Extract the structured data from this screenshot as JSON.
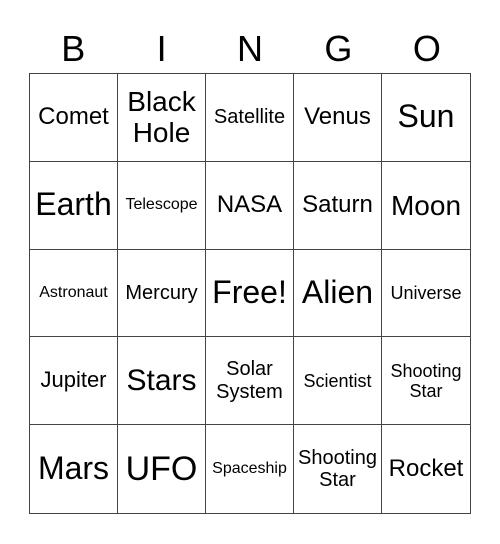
{
  "header": [
    "B",
    "I",
    "N",
    "G",
    "O"
  ],
  "cells": [
    "Comet",
    "Black\nHole",
    "Satellite",
    "Venus",
    "Sun",
    "Earth",
    "Telescope",
    "NASA",
    "Saturn",
    "Moon",
    "Astronaut",
    "Mercury",
    "Free!",
    "Alien",
    "Universe",
    "Jupiter",
    "Stars",
    "Solar\nSystem",
    "Scientist",
    "Shooting\nStar",
    "Mars",
    "UFO",
    "Spaceship",
    "Shooting\nStar",
    "Rocket"
  ]
}
